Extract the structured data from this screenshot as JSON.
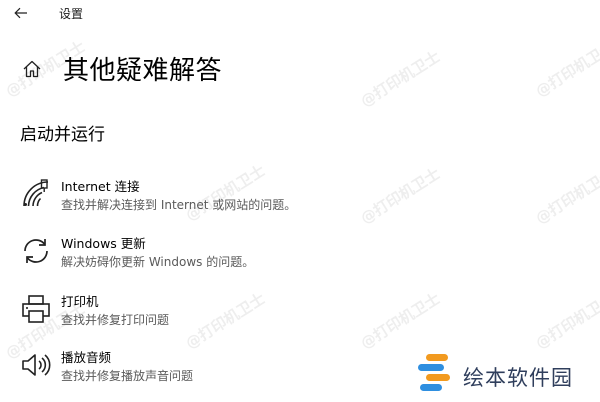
{
  "header": {
    "app_title": "设置"
  },
  "page": {
    "title": "其他疑难解答",
    "section_title": "启动并运行"
  },
  "items": [
    {
      "title": "Internet 连接",
      "desc": "查找并解决连接到 Internet 或网站的问题。",
      "icon": "wifi-icon"
    },
    {
      "title": "Windows 更新",
      "desc": "解决妨碍你更新 Windows 的问题。",
      "icon": "refresh-icon"
    },
    {
      "title": "打印机",
      "desc": "查找并修复打印问题",
      "icon": "printer-icon"
    },
    {
      "title": "播放音频",
      "desc": "查找并修复播放声音问题",
      "icon": "speaker-icon"
    }
  ],
  "watermark": {
    "text": "@打印机卫士"
  },
  "brand": {
    "name": "绘本软件园",
    "colors": [
      "#f29a1f",
      "#2f8fe0"
    ]
  }
}
